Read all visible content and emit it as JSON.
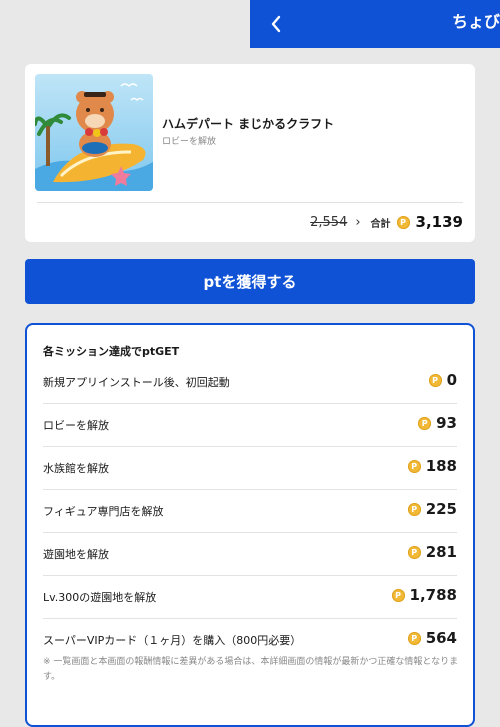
{
  "header": {
    "title": "ちょびリッチアプリ"
  },
  "app": {
    "name": "ハムデパート まじかるクラフト",
    "condition": "ロビーを解放",
    "old_points": "2,554",
    "total_label": "合計",
    "total_points": "3,139"
  },
  "coin_symbol": "P",
  "get_button": {
    "label": "ptを獲得する"
  },
  "missions": {
    "heading": "各ミッション達成でptGET",
    "items": [
      {
        "label": "新規アプリインストール後、初回起動",
        "points": "0"
      },
      {
        "label": "ロビーを解放",
        "points": "93"
      },
      {
        "label": "水族館を解放",
        "points": "188"
      },
      {
        "label": "フィギュア専門店を解放",
        "points": "225"
      },
      {
        "label": "遊園地を解放",
        "points": "281"
      },
      {
        "label": "Lv.300の遊園地を解放",
        "points": "1,788"
      },
      {
        "label": "スーパーVIPカード（１ヶ月）を購入（800円必要）",
        "points": "564"
      }
    ],
    "note": "※ 一覧画面と本画面の報酬情報に差異がある場合は、本詳細画面の情報が最新かつ正確な情報となります。"
  },
  "colors": {
    "primary": "#0f52d6",
    "background": "#e8e8e8",
    "coin": "#f2b936"
  }
}
